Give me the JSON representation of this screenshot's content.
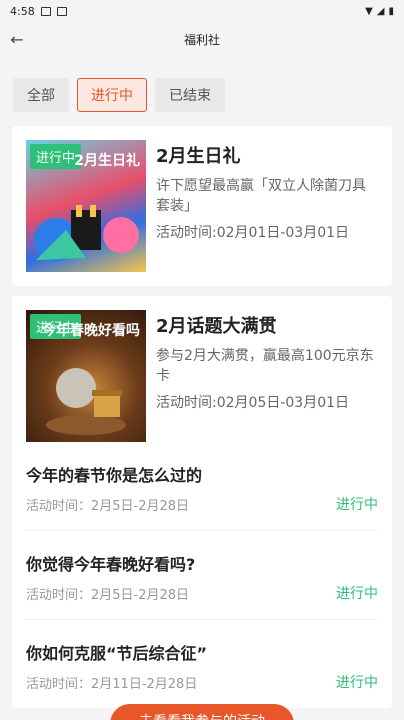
{
  "status_bar": {
    "time": "4:58"
  },
  "nav": {
    "title": "福利社"
  },
  "tabs": [
    {
      "label": "全部"
    },
    {
      "label": "进行中"
    },
    {
      "label": "已结束"
    }
  ],
  "featured": [
    {
      "badge": "进行中",
      "thumb_text": "2月生日礼",
      "title": "2月生日礼",
      "desc": "许下愿望最高赢「双立人除菌刀具套装」",
      "time": "活动时间:02月01日-03月01日"
    },
    {
      "badge": "进行中",
      "thumb_text": "今年春晚好看吗",
      "title": "2月话题大满贯",
      "desc": "参与2月大满贯，赢最高100元京东卡",
      "time": "活动时间:02月05日-03月01日"
    }
  ],
  "topics": [
    {
      "title": "今年的春节你是怎么过的",
      "time": "活动时间：2月5日-2月28日",
      "status": "进行中"
    },
    {
      "title": "你觉得今年春晚好看吗?",
      "time": "活动时间：2月5日-2月28日",
      "status": "进行中"
    },
    {
      "title": "你如何克服“节后综合征”",
      "time": "活动时间：2月11日-2月28日",
      "status": "进行中"
    }
  ],
  "float_button": {
    "label": "去看看我参与的活动"
  },
  "colors": {
    "accent": "#e8572a",
    "status_green": "#2ebf78"
  }
}
